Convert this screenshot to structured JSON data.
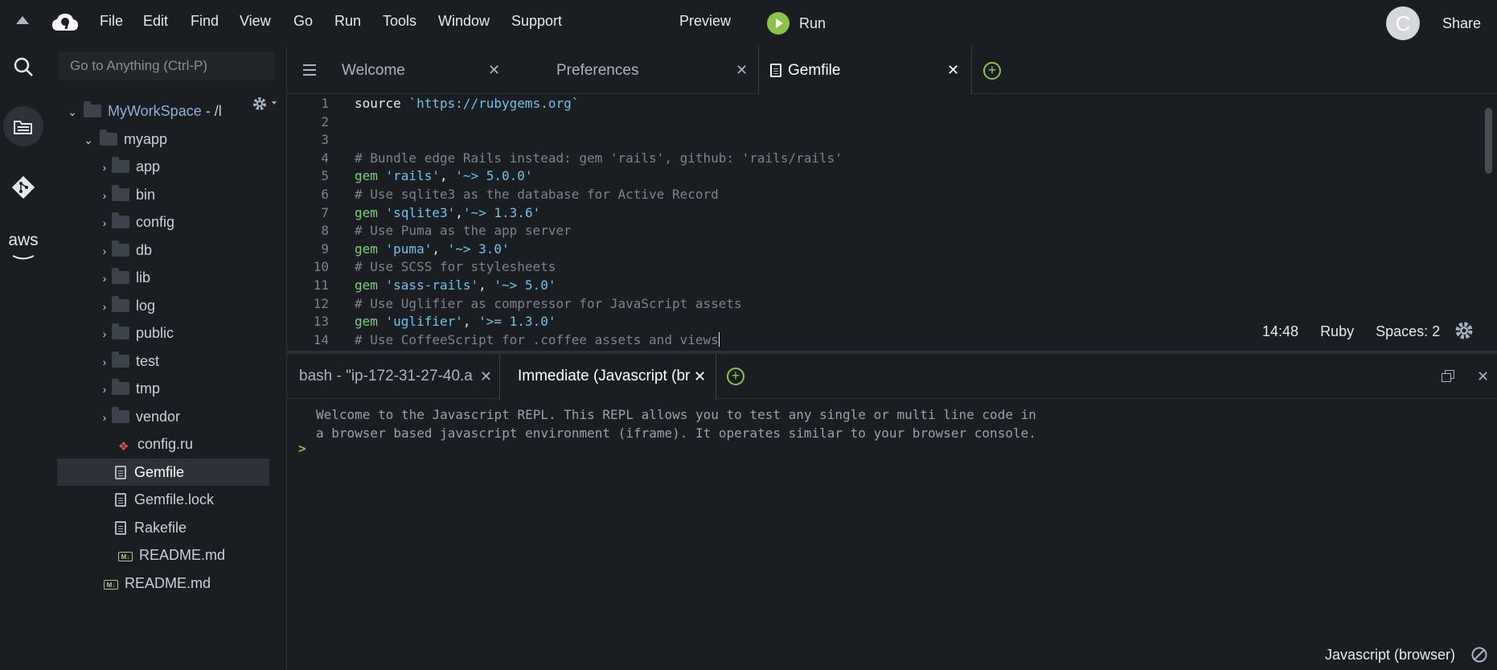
{
  "menubar": {
    "menus": [
      "File",
      "Edit",
      "Find",
      "View",
      "Go",
      "Run",
      "Tools",
      "Window",
      "Support"
    ],
    "preview_label": "Preview",
    "run_label": "Run",
    "avatar_letter": "C",
    "share_label": "Share"
  },
  "activitybar": {
    "aws_label": "aws"
  },
  "sidebar": {
    "goto_placeholder": "Go to Anything (Ctrl-P)",
    "workspace_name": "MyWorkSpace",
    "workspace_suffix": " - /l",
    "project": "myapp",
    "folders": [
      "app",
      "bin",
      "config",
      "db",
      "lib",
      "log",
      "public",
      "test",
      "tmp",
      "vendor"
    ],
    "files": [
      "config.ru",
      "Gemfile",
      "Gemfile.lock",
      "Rakefile",
      "README.md"
    ],
    "selected_file": "Gemfile",
    "root_files": [
      "README.md"
    ]
  },
  "editor": {
    "tabs": [
      {
        "label": "Welcome"
      },
      {
        "label": "Preferences"
      },
      {
        "label": "Gemfile"
      }
    ],
    "lines": [
      {
        "n": "1",
        "parts": [
          [
            "plain",
            "source "
          ],
          [
            "str",
            "`https://rubygems.org`"
          ]
        ]
      },
      {
        "n": "2",
        "parts": []
      },
      {
        "n": "3",
        "parts": []
      },
      {
        "n": "4",
        "parts": [
          [
            "comment",
            "# Bundle edge Rails instead: gem 'rails', github: 'rails/rails'"
          ]
        ]
      },
      {
        "n": "5",
        "parts": [
          [
            "kw",
            "gem "
          ],
          [
            "str",
            "'rails'"
          ],
          [
            "plain",
            ", "
          ],
          [
            "str",
            "'~> 5.0.0'"
          ]
        ]
      },
      {
        "n": "6",
        "parts": [
          [
            "comment",
            "# Use sqlite3 as the database for Active Record"
          ]
        ]
      },
      {
        "n": "7",
        "parts": [
          [
            "kw",
            "gem "
          ],
          [
            "str",
            "'sqlite3'"
          ],
          [
            "plain",
            ","
          ],
          [
            "str",
            "'~> 1.3.6'"
          ]
        ]
      },
      {
        "n": "8",
        "parts": [
          [
            "comment",
            "# Use Puma as the app server"
          ]
        ]
      },
      {
        "n": "9",
        "parts": [
          [
            "kw",
            "gem "
          ],
          [
            "str",
            "'puma'"
          ],
          [
            "plain",
            ", "
          ],
          [
            "str",
            "'~> 3.0'"
          ]
        ]
      },
      {
        "n": "10",
        "parts": [
          [
            "comment",
            "# Use SCSS for stylesheets"
          ]
        ]
      },
      {
        "n": "11",
        "parts": [
          [
            "kw",
            "gem "
          ],
          [
            "str",
            "'sass-rails'"
          ],
          [
            "plain",
            ", "
          ],
          [
            "str",
            "'~> 5.0'"
          ]
        ]
      },
      {
        "n": "12",
        "parts": [
          [
            "comment",
            "# Use Uglifier as compressor for JavaScript assets"
          ]
        ]
      },
      {
        "n": "13",
        "parts": [
          [
            "kw",
            "gem "
          ],
          [
            "str",
            "'uglifier'"
          ],
          [
            "plain",
            ", "
          ],
          [
            "str",
            "'>= 1.3.0'"
          ]
        ]
      },
      {
        "n": "14",
        "parts": [
          [
            "comment",
            "# Use CoffeeScript for .coffee assets and views"
          ]
        ]
      }
    ],
    "status": {
      "position": "14:48",
      "language": "Ruby",
      "spaces": "Spaces: 2"
    }
  },
  "panel": {
    "tabs": [
      {
        "label": "bash - \"ip-172-31-27-40.a"
      },
      {
        "label": "Immediate (Javascript (br"
      }
    ],
    "repl_welcome_1": "Welcome to the Javascript REPL. This REPL allows you to test any single or multi line code in",
    "repl_welcome_2": "a browser based javascript environment (iframe). It operates similar to your browser console.",
    "prompt": ">",
    "language": "Javascript (browser)"
  },
  "colors": {
    "background": "#1a1d21",
    "accent_green": "#8bc34a",
    "keyword": "#7fce7f",
    "string": "#6ec3e8",
    "comment": "#7c838c"
  }
}
